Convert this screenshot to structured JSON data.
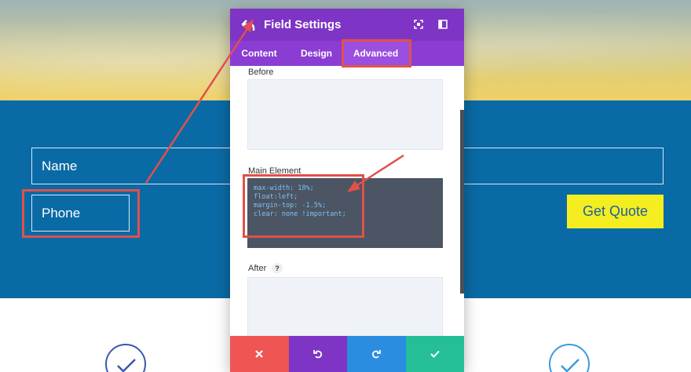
{
  "page": {
    "name_placeholder": "Name",
    "phone_placeholder": "Phone",
    "quote_button": "Get Quote"
  },
  "modal": {
    "title": "Field Settings",
    "tabs": [
      {
        "label": "Content",
        "active": false
      },
      {
        "label": "Design",
        "active": false
      },
      {
        "label": "Advanced",
        "active": true
      }
    ],
    "fields": {
      "before_label": "Before",
      "main_label": "Main Element",
      "main_value": "max-width: 18%;\nfloat:left;\nmargin-top: -1.5%;\nclear: none !important;",
      "after_label": "After",
      "help_text": "?"
    },
    "footer_icons": [
      "close-icon",
      "undo-icon",
      "redo-icon",
      "check-icon"
    ]
  },
  "colors": {
    "modal_header": "#7e34c5",
    "tabs_bar": "#8b3dd3",
    "band": "#0a6aa5",
    "quote_button": "#f4ee21",
    "annotation": "#e2504a",
    "footer_close": "#ee5553",
    "footer_undo": "#7e34c5",
    "footer_redo": "#2b8de0",
    "footer_save": "#24bf97"
  }
}
